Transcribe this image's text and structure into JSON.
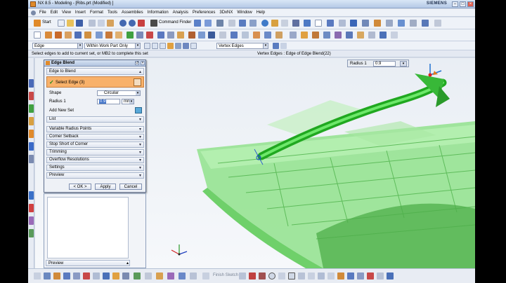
{
  "window": {
    "title": "NX 8.5 - Modeling - [Ribs.prt (Modified) ]",
    "brand": "SIEMENS",
    "controls": [
      "–",
      "□",
      "×"
    ]
  },
  "menu": [
    "File",
    "Edit",
    "View",
    "Insert",
    "Format",
    "Tools",
    "Assemblies",
    "Information",
    "Analysis",
    "Preferences",
    "3DxNX",
    "Window",
    "Help"
  ],
  "toolbar": {
    "start_label": "Start",
    "command_finder_label": "Command Finder"
  },
  "selection_bar": {
    "filter_value": "Edge",
    "scope_value": "Within Work Part Only",
    "curve_rule_value": "Vertex Edges"
  },
  "cue_line": {
    "prompt": "Select edges to add to current set, or MB2 to complete this set",
    "status": "Vertex Edges : Edge of Edge Blend(22)"
  },
  "onscreen_input": {
    "label": "Radius 1",
    "value": "0.9"
  },
  "dialog": {
    "title": "Edge Blend",
    "group_edge": "Edge to Blend",
    "select_edge_label": "Select Edge (3)",
    "shape_label": "Shape",
    "shape_value": "Circular",
    "radius_label": "Radius 1",
    "radius_value": "0.9",
    "radius_unit": "mm",
    "add_new_set_label": "Add New Set",
    "list_label": "List",
    "sections": [
      "Variable Radius Points",
      "Corner Setback",
      "Stop Short of Corner",
      "Trimming",
      "Overflow Resolutions",
      "Settings",
      "Preview"
    ],
    "ok_label": "< OK >",
    "apply_label": "Apply",
    "cancel_label": "Cancel"
  },
  "navigator": {
    "preview_label": "Preview"
  },
  "bottom_toolbar": {
    "sketch_label": "Finish Sketch"
  },
  "colors": {
    "model_green": "#7ee07a",
    "edge_blend_green": "#20c020",
    "selection_orange": "#f8b16a"
  }
}
